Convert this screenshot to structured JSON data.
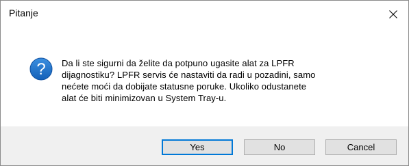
{
  "window": {
    "title": "Pitanje",
    "close_icon": "close-icon"
  },
  "message": {
    "icon": "question-icon",
    "text": "Da li ste sigurni da želite da potpuno ugasite alat za LPFR\ndijagnostiku? LPFR servis će nastaviti da radi u pozadini, samo\nnećete moći da dobijate statusne poruke. Ukoliko odustanete\nalat će biti minimizovan u System Tray-u."
  },
  "buttons": {
    "yes": "Yes",
    "no": "No",
    "cancel": "Cancel"
  },
  "colors": {
    "icon_blue": "#1a6fc9",
    "default_button_border": "#0078d7",
    "footer_background": "#f0f0f0"
  }
}
